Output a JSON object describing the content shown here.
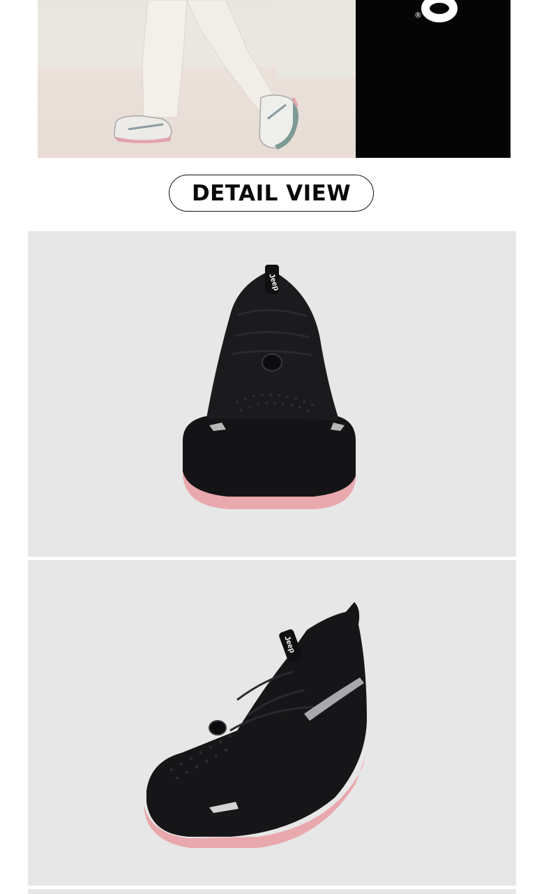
{
  "hero": {
    "brand_mark_text": "®"
  },
  "section_button": {
    "label": "DETAIL VIEW"
  },
  "details": {
    "front_logo_text": "Jeep",
    "side_logo_text": "Jeep"
  },
  "colors": {
    "panel_bg": "#e7e7e7",
    "shoe_black": "#141416",
    "sole_pink": "#e8a8ad",
    "reflective_silver": "#b8b8b8"
  }
}
